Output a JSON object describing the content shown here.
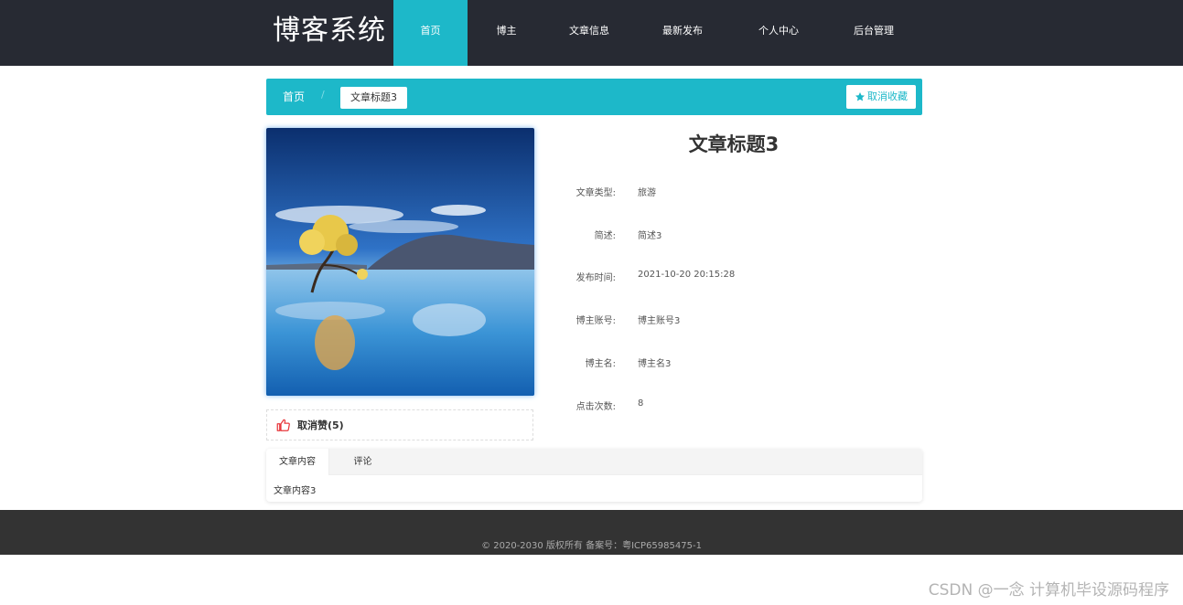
{
  "header": {
    "logo": "博客系统",
    "nav": [
      {
        "label": "首页",
        "active": true
      },
      {
        "label": "博主",
        "active": false
      },
      {
        "label": "文章信息",
        "active": false
      },
      {
        "label": "最新发布",
        "active": false
      },
      {
        "label": "个人中心",
        "active": false
      },
      {
        "label": "后台管理",
        "active": false
      }
    ]
  },
  "breadcrumb": {
    "home": "首页",
    "separator": "/",
    "current": "文章标题3",
    "unfavorite_label": "取消收藏"
  },
  "like": {
    "label": "取消赞(5)"
  },
  "article": {
    "title": "文章标题3",
    "fields": [
      {
        "label": "文章类型:",
        "value": "旅游"
      },
      {
        "label": "简述:",
        "value": "简述3"
      },
      {
        "label": "发布时间:",
        "value": "2021-10-20 20:15:28"
      },
      {
        "label": "博主账号:",
        "value": "博主账号3"
      },
      {
        "label": "博主名:",
        "value": "博主名3"
      },
      {
        "label": "点击次数:",
        "value": "8"
      }
    ]
  },
  "tabs": {
    "items": [
      {
        "label": "文章内容",
        "active": true
      },
      {
        "label": "评论",
        "active": false
      }
    ],
    "content": "文章内容3"
  },
  "footer": {
    "text": "© 2020-2030 版权所有 备案号：粤ICP65985475-1"
  },
  "watermark": "CSDN @一念 计算机毕设源码程序",
  "colors": {
    "accent": "#1db8c9",
    "header_bg": "#272a33",
    "footer_bg": "#333333",
    "like_icon": "#e8383d"
  }
}
